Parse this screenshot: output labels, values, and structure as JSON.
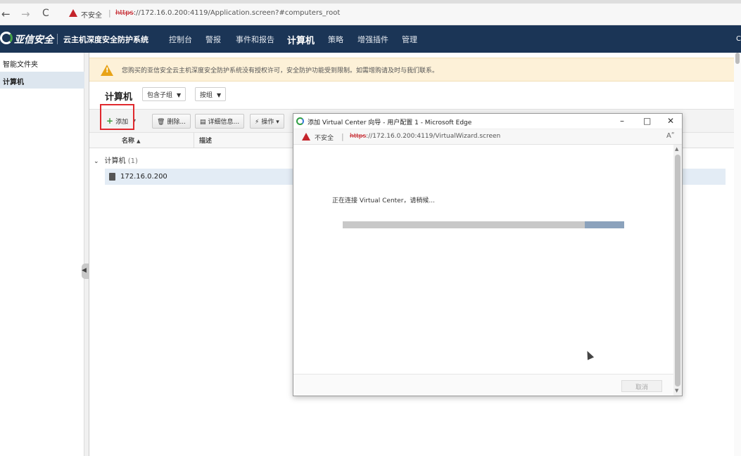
{
  "browser": {
    "nav_back": "←",
    "nav_forward": "→",
    "nav_reload": "C",
    "unsafe_label": "不安全",
    "url_scheme": "https",
    "url_rest": "://172.16.0.200:4119/Application.screen?#computers_root"
  },
  "header": {
    "logo_text": "亚信安全",
    "system_name": "云主机深度安全防护系统",
    "nav": [
      "控制台",
      "警报",
      "事件和报告",
      "计算机",
      "策略",
      "增强插件",
      "管理"
    ],
    "active_nav": "计算机",
    "right_text": "C"
  },
  "sidebar": {
    "items": [
      {
        "label": "智能文件夹",
        "selected": false
      },
      {
        "label": "计算机",
        "selected": true
      }
    ]
  },
  "banner": {
    "text": "您购买的亚信安全云主机深度安全防护系统没有授权许可，安全防护功能受到限制。如需增购请及时与我们联系。"
  },
  "main": {
    "title": "计算机",
    "filter_subgroups": "包含子组",
    "filter_group": "按组"
  },
  "toolbar": {
    "add": "添加",
    "add_caret": "▾",
    "delete": "删除...",
    "details": "详细信息...",
    "actions": "操作",
    "actions_caret": "▾"
  },
  "table": {
    "columns": [
      "名称",
      "描述"
    ],
    "sort_indicator": "▲",
    "group_label": "计算机",
    "group_count": "(1)",
    "rows": [
      {
        "name": "172.16.0.200"
      }
    ]
  },
  "dialog": {
    "title": "添加 Virtual Center 向导 - 用户配置 1 - Microsoft Edge",
    "minimize": "–",
    "maximize": "□",
    "close": "✕",
    "unsafe_label": "不安全",
    "url_scheme": "https",
    "url_rest": "://172.16.0.200:4119/VirtualWizard.screen",
    "reader_icon": "Aʺ",
    "message": "正在连接 Virtual Center，请稍候...",
    "progress_start": 0.86,
    "progress_end": 1.0,
    "cancel": "取消"
  }
}
